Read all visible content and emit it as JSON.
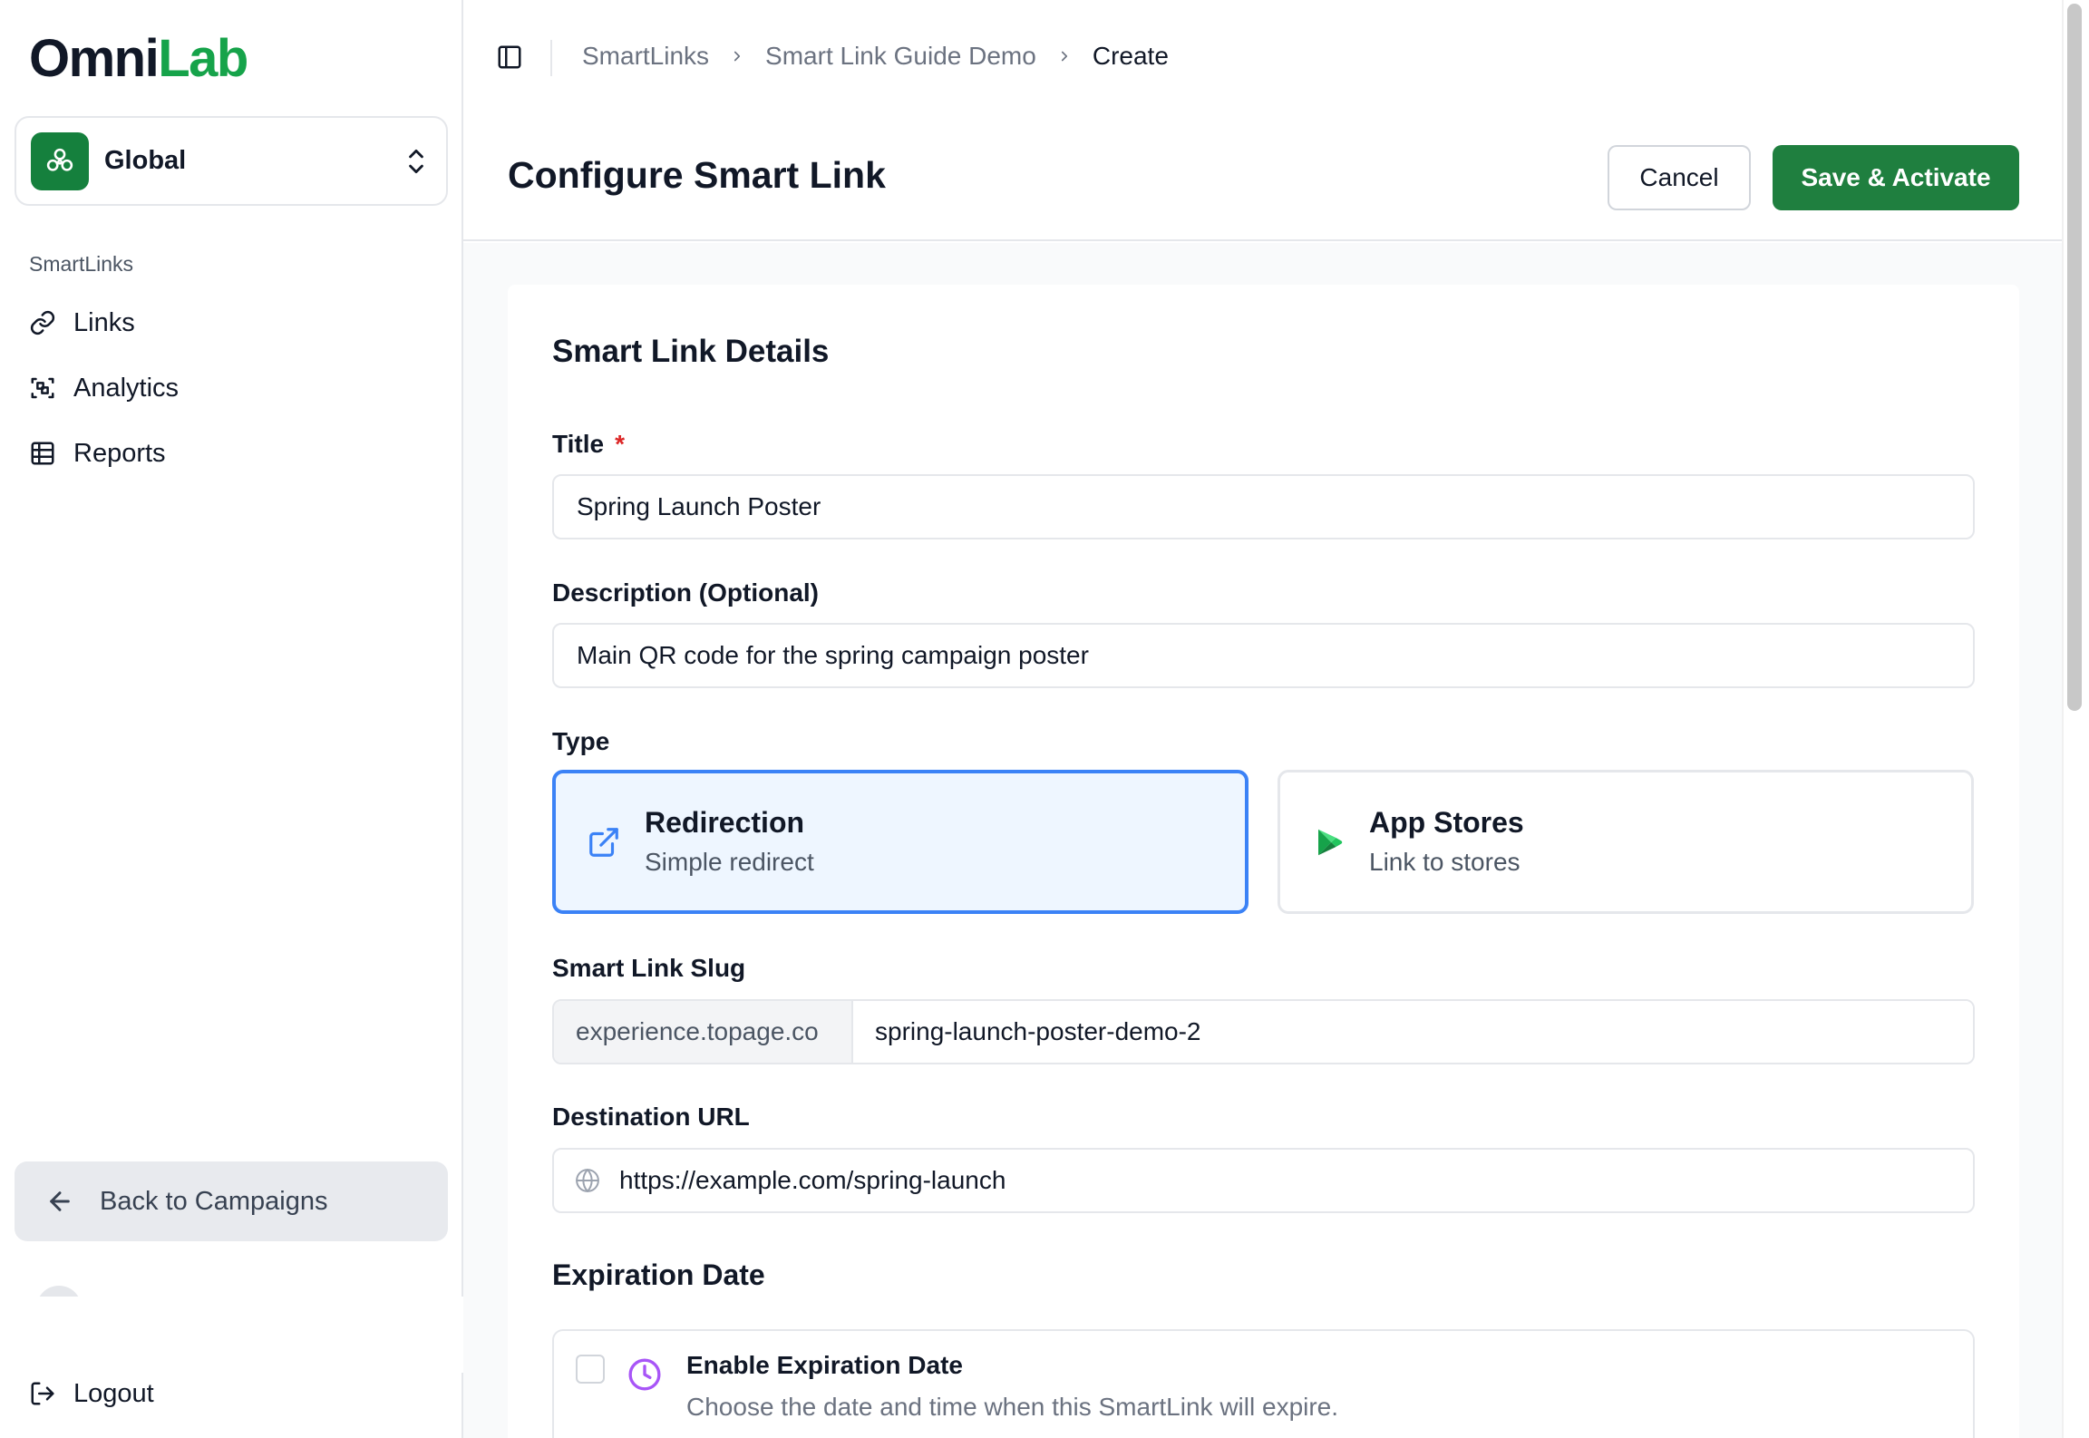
{
  "brand": {
    "logo_part1": "Omni",
    "logo_part2": "Lab"
  },
  "workspace": {
    "name": "Global"
  },
  "sidebar": {
    "section_label": "SmartLinks",
    "items": [
      {
        "label": "Links",
        "icon": "link-icon"
      },
      {
        "label": "Analytics",
        "icon": "analytics-scan-icon"
      },
      {
        "label": "Reports",
        "icon": "table-icon"
      }
    ],
    "back_label": "Back to Campaigns",
    "logout_label": "Logout"
  },
  "breadcrumb": {
    "items": [
      "SmartLinks",
      "Smart Link Guide Demo",
      "Create"
    ]
  },
  "header": {
    "title": "Configure Smart Link",
    "cancel_label": "Cancel",
    "save_label": "Save & Activate"
  },
  "form": {
    "card_title": "Smart Link Details",
    "title_label": "Title",
    "required_mark": "*",
    "title_value": "Spring Launch Poster",
    "description_label": "Description (Optional)",
    "description_value": "Main QR code for the spring campaign poster",
    "type_label": "Type",
    "types": [
      {
        "name": "Redirection",
        "subtitle": "Simple redirect",
        "selected": true,
        "icon": "external-link-icon"
      },
      {
        "name": "App Stores",
        "subtitle": "Link to stores",
        "selected": false,
        "icon": "play-store-icon"
      }
    ],
    "slug_label": "Smart Link Slug",
    "slug_prefix": "experience.topage.co",
    "slug_value": "spring-launch-poster-demo-2",
    "destination_label": "Destination URL",
    "destination_value": "https://example.com/spring-launch",
    "expiration_heading": "Expiration Date",
    "expiration_enable_label": "Enable Expiration Date",
    "expiration_enable_checked": false,
    "expiration_description": "Choose the date and time when this SmartLink will expire."
  },
  "colors": {
    "brand_green": "#16a34a",
    "primary_button": "#1f7f3f",
    "selected_border": "#3b82f6",
    "selected_bg": "#eef6ff",
    "required_red": "#dc2626",
    "clock_purple": "#a855f7"
  }
}
